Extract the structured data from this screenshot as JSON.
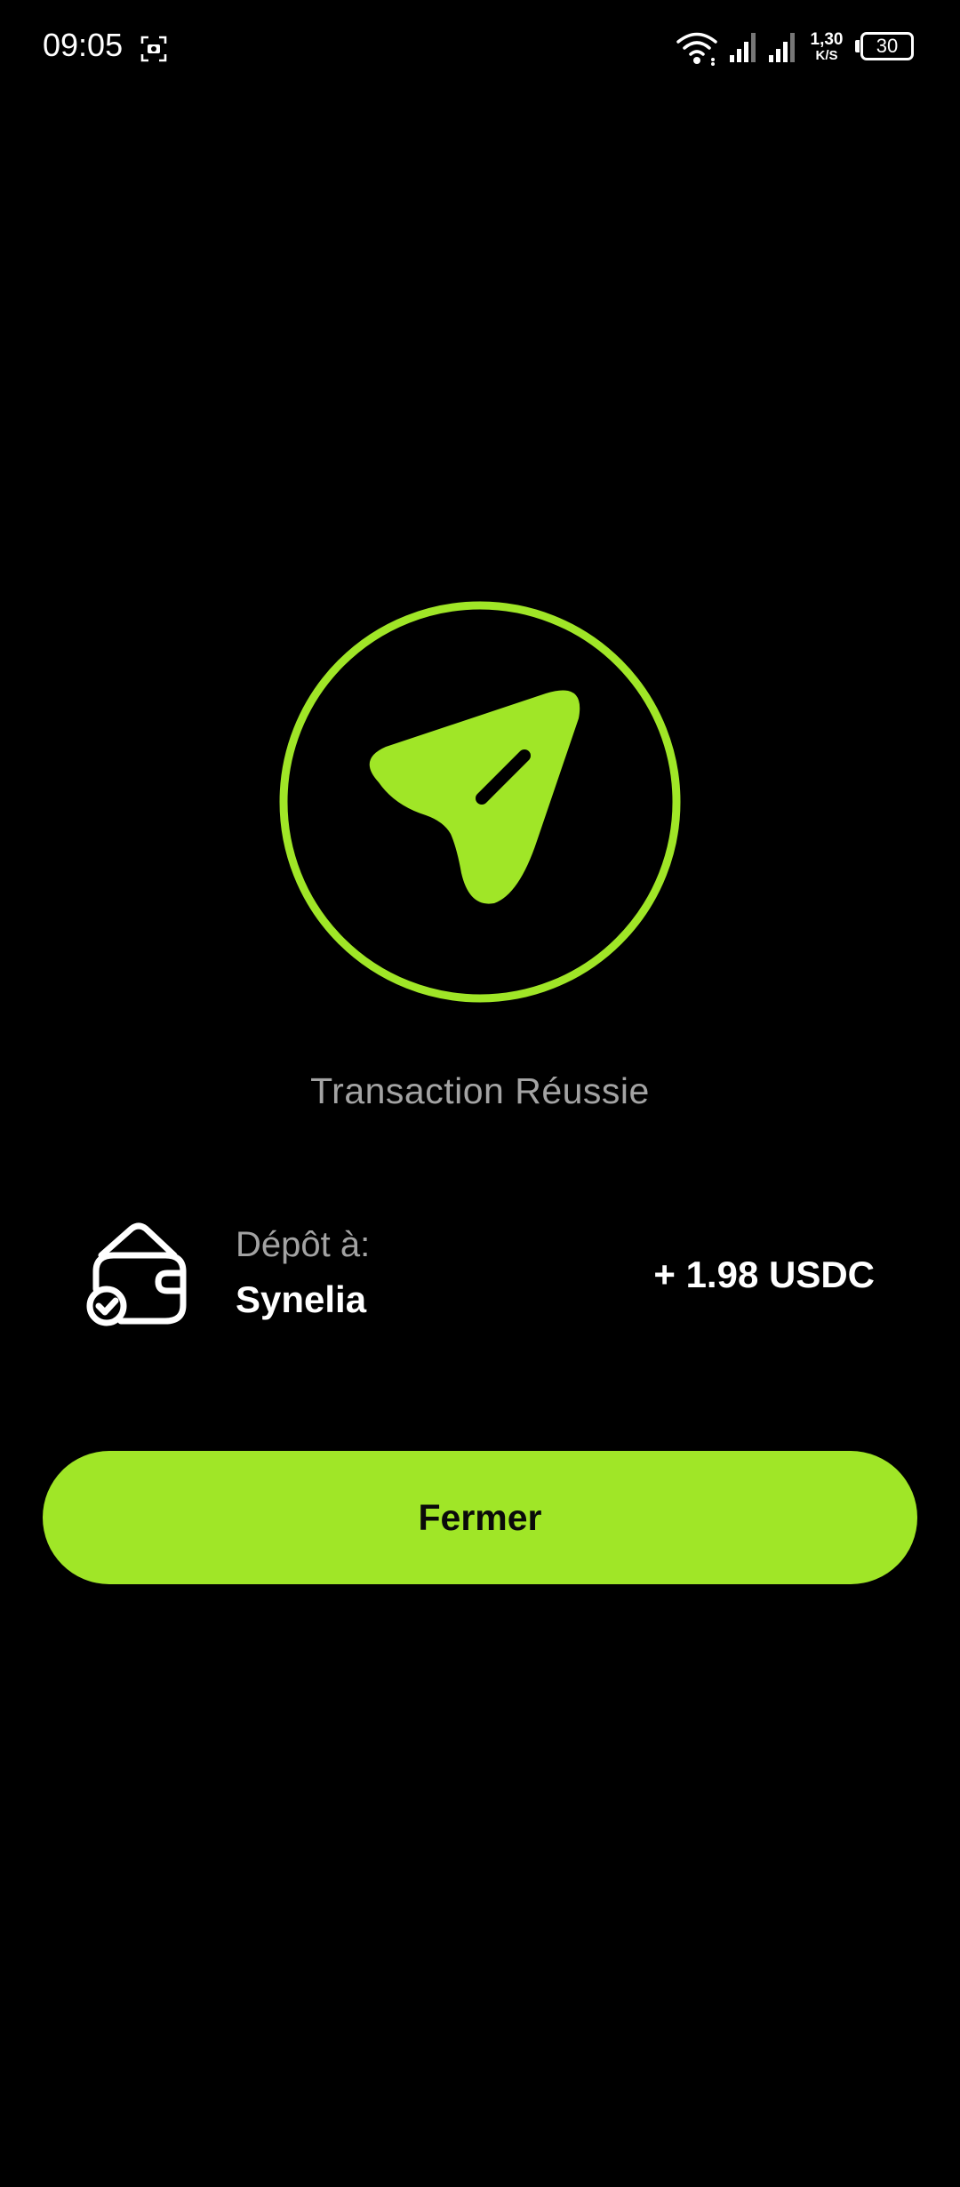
{
  "status_bar": {
    "time": "09:05",
    "net_speed_value": "1,30",
    "net_speed_unit": "K/S",
    "battery": "30",
    "icons": [
      "screenshot-icon",
      "wifi-icon",
      "signal-icon",
      "signal-icon",
      "battery-icon"
    ]
  },
  "success": {
    "icon": "send-icon",
    "title": "Transaction Réussie"
  },
  "deposit": {
    "icon": "wallet-check-icon",
    "label": "Dépôt à:",
    "recipient": "Synelia",
    "amount": "+ 1.98 USDC"
  },
  "actions": {
    "close_label": "Fermer"
  },
  "colors": {
    "background": "#000000",
    "accent": "#a0e627",
    "muted_text": "#a3a3a3",
    "text": "#ffffff"
  }
}
